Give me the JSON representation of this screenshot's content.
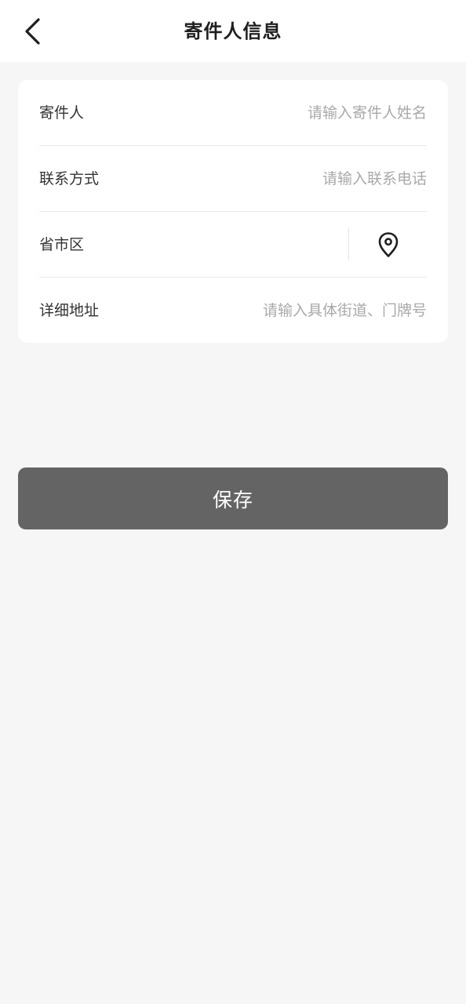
{
  "header": {
    "title": "寄件人信息",
    "back_icon": "chevron-left-icon"
  },
  "form": {
    "sender": {
      "label": "寄件人",
      "value": "",
      "placeholder": "请输入寄件人姓名"
    },
    "contact": {
      "label": "联系方式",
      "value": "",
      "placeholder": "请输入联系电话"
    },
    "region": {
      "label": "省市区",
      "value": "",
      "icon": "location-pin-icon"
    },
    "address": {
      "label": "详细地址",
      "value": "",
      "placeholder": "请输入具体街道、门牌号"
    }
  },
  "actions": {
    "save_label": "保存"
  },
  "colors": {
    "background": "#f6f6f6",
    "card": "#ffffff",
    "button": "#646464",
    "placeholder": "#a9a9a9",
    "text": "#333333"
  }
}
